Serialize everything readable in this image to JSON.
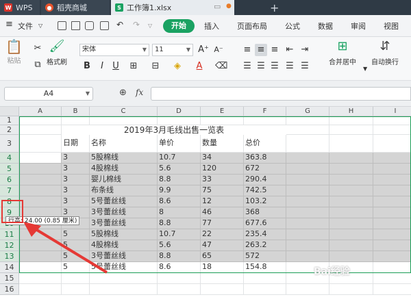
{
  "titlebar": {
    "wps_tab": "WPS",
    "shop_tab": "稻壳商城",
    "file_tab": "工作簿1.xlsx",
    "add_tab": "+"
  },
  "menu": {
    "file": "文件",
    "start": "开始",
    "items": [
      "插入",
      "页面布局",
      "公式",
      "数据",
      "审阅",
      "视图"
    ]
  },
  "ribbon": {
    "paste": "粘贴",
    "format_painter": "格式刷",
    "font_name": "宋体",
    "font_size": "11",
    "merge_center": "合并居中",
    "wrap_text": "自动换行",
    "bold": "B",
    "italic": "I",
    "underline": "U",
    "font_color": "A"
  },
  "formula_bar": {
    "name_box": "A4",
    "fx": "fx",
    "value": ""
  },
  "sheet": {
    "columns": [
      "A",
      "B",
      "C",
      "D",
      "E",
      "F",
      "G",
      "H",
      "I"
    ],
    "rows": [
      "1",
      "2",
      "3",
      "4",
      "5",
      "6",
      "7",
      "8",
      "9",
      "10",
      "11",
      "12",
      "13",
      "14",
      "15",
      "16"
    ],
    "title": "2019年3月毛线出售一览表",
    "headers": [
      "日期",
      "名称",
      "单价",
      "数量",
      "总价"
    ],
    "data": [
      [
        "3",
        "5股棉线",
        "10.7",
        "34",
        "363.8"
      ],
      [
        "3",
        "4股棉线",
        "5.6",
        "120",
        "672"
      ],
      [
        "3",
        "婴儿棉线",
        "8.8",
        "33",
        "290.4"
      ],
      [
        "3",
        "布条线",
        "9.9",
        "75",
        "742.5"
      ],
      [
        "3",
        "5号蕾丝线",
        "8.6",
        "12",
        "103.2"
      ],
      [
        "3",
        "3号蕾丝线",
        "8",
        "46",
        "368"
      ],
      [
        "3",
        "3号蕾丝线",
        "8.8",
        "77",
        "677.6"
      ],
      [
        "5",
        "5股棉线",
        "10.7",
        "22",
        "235.4"
      ],
      [
        "5",
        "4股棉线",
        "5.6",
        "47",
        "263.2"
      ],
      [
        "5",
        "3号蕾丝线",
        "8.8",
        "65",
        "572"
      ],
      [
        "5",
        "5号蕾丝线",
        "8.6",
        "18",
        "154.8"
      ]
    ],
    "tooltip": "行高: 24.00 (0.85 厘米)",
    "watermark": "Bai经验"
  }
}
